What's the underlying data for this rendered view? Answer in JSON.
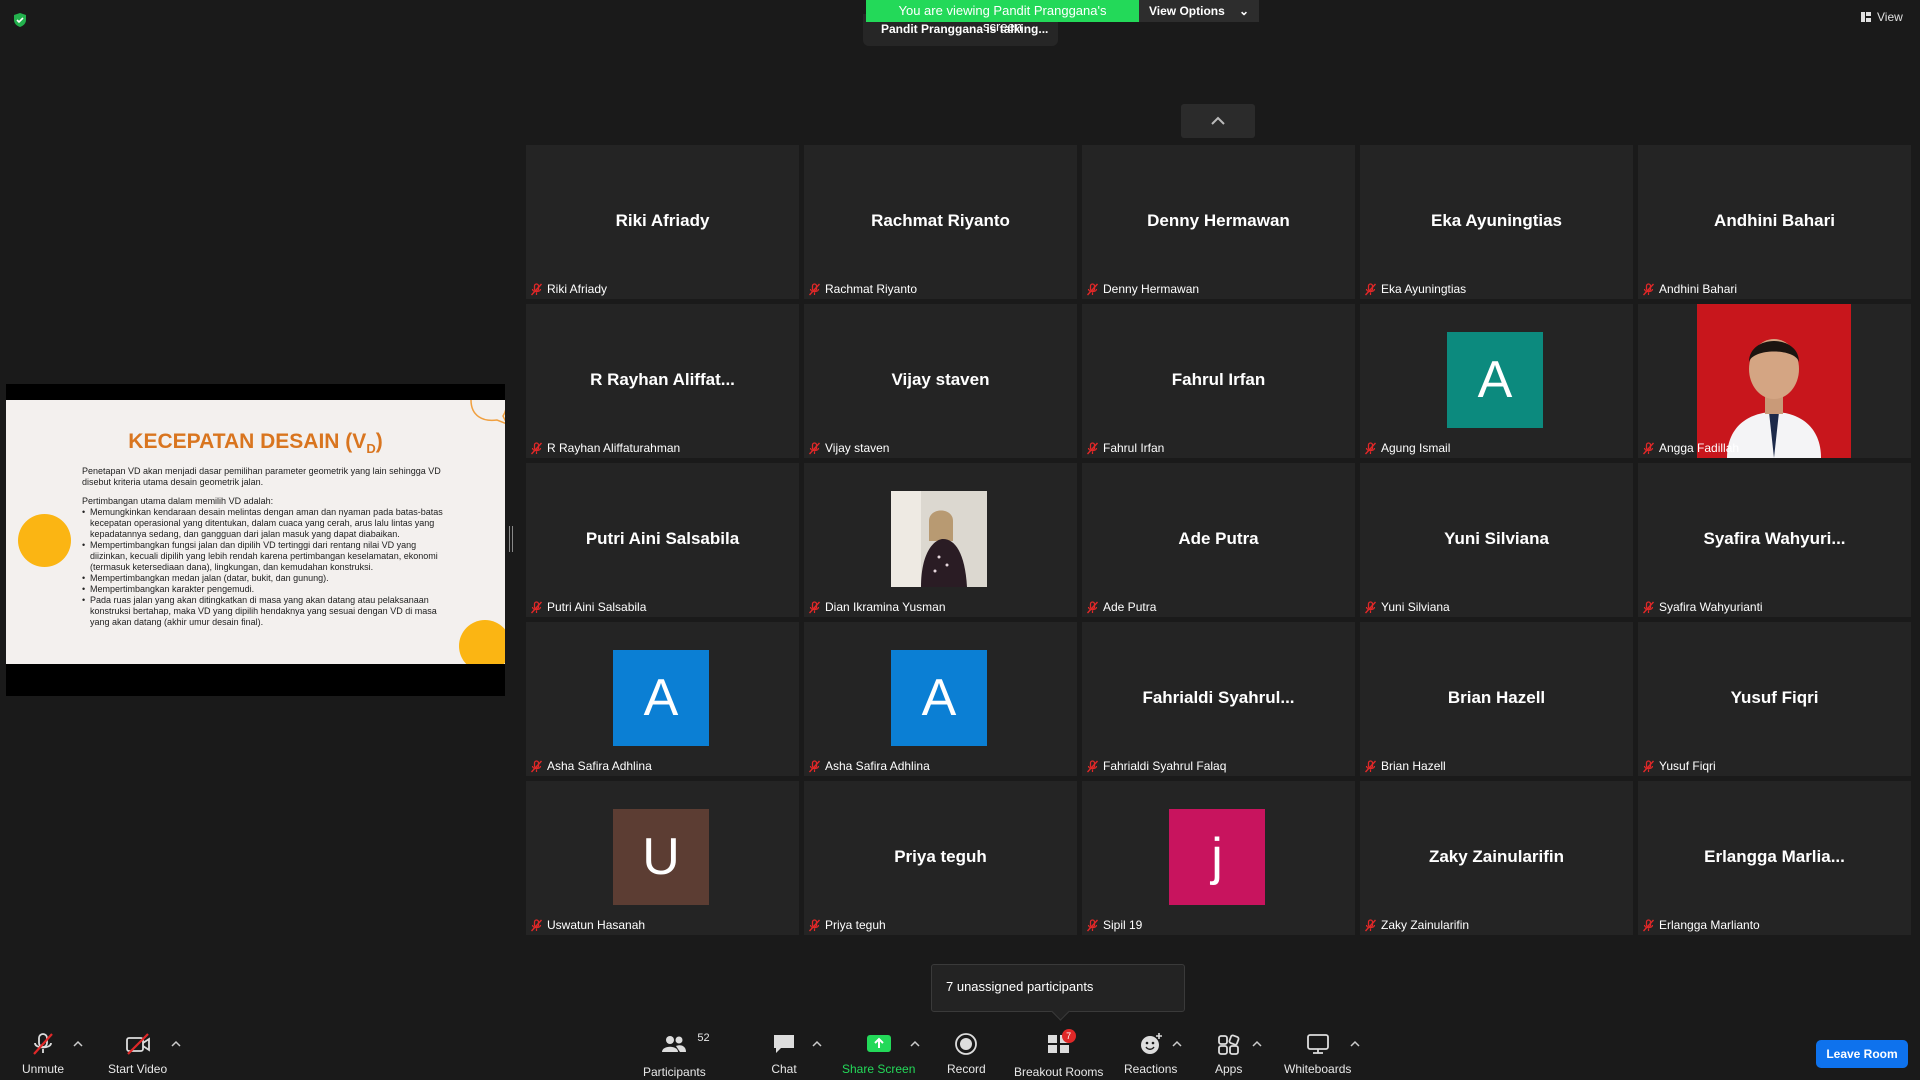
{
  "banner": {
    "viewing_text": "You are viewing Pandit Pranggana's screen",
    "view_options_label": "View Options",
    "talking_text": "Pandit Pranggana is talking..."
  },
  "top_right": {
    "view_label": "View"
  },
  "slide": {
    "title": "KECEPATAN DESAIN (V",
    "title_sub": "D",
    "title_end": ")",
    "intro": "Penetapan VD akan menjadi dasar pemilihan parameter geometrik yang lain sehingga VD disebut kriteria utama desain geometrik jalan.",
    "consider_heading": "Pertimbangan utama dalam memilih VD adalah:",
    "bullets": [
      "Memungkinkan kendaraan desain melintas dengan aman dan nyaman pada batas-batas kecepatan operasional yang ditentukan, dalam cuaca yang cerah, arus lalu lintas yang kepadatannya sedang, dan gangguan dari jalan masuk yang dapat diabaikan.",
      "Mempertimbangkan fungsi jalan dan dipilih VD tertinggi dari rentang nilai VD yang diizinkan, kecuali dipilih yang lebih rendah karena pertimbangan keselamatan, ekonomi (termasuk ketersediaan dana), lingkungan, dan kemudahan konstruksi.",
      "Mempertimbangkan medan jalan (datar, bukit, dan gunung).",
      "Mempertimbangkan karakter pengemudi.",
      "Pada ruas jalan yang akan ditingkatkan di masa yang akan datang atau pelaksanaan konstruksi bertahap, maka VD yang dipilih hendaknya yang sesuai dengan VD di masa yang akan datang (akhir umur desain final)."
    ]
  },
  "tiles": [
    {
      "center": "Riki Afriady",
      "label": "Riki Afriady",
      "type": "name"
    },
    {
      "center": "Rachmat Riyanto",
      "label": "Rachmat Riyanto",
      "type": "name"
    },
    {
      "center": "Denny Hermawan",
      "label": "Denny Hermawan",
      "type": "name"
    },
    {
      "center": "Eka Ayuningtias",
      "label": "Eka Ayuningtias",
      "type": "name"
    },
    {
      "center": "Andhini Bahari",
      "label": "Andhini Bahari",
      "type": "name"
    },
    {
      "center": "R Rayhan Aliffat...",
      "label": "R Rayhan Aliffaturahman",
      "type": "name"
    },
    {
      "center": "Vijay staven",
      "label": "Vijay staven",
      "type": "name"
    },
    {
      "center": "Fahrul Irfan",
      "label": "Fahrul Irfan",
      "type": "name"
    },
    {
      "center": "A",
      "label": "Agung Ismail",
      "type": "avatar",
      "color": "#0c8a7e"
    },
    {
      "center": "",
      "label": "Angga Fadillah",
      "type": "photo"
    },
    {
      "center": "Putri Aini Salsabila",
      "label": "Putri Aini Salsabila",
      "type": "name"
    },
    {
      "center": "",
      "label": "Dian Ikramina Yusman",
      "type": "photo-small"
    },
    {
      "center": "Ade Putra",
      "label": "Ade Putra",
      "type": "name"
    },
    {
      "center": "Yuni Silviana",
      "label": "Yuni Silviana",
      "type": "name"
    },
    {
      "center": "Syafira  Wahyuri...",
      "label": "Syafira Wahyurianti",
      "type": "name"
    },
    {
      "center": "A",
      "label": "Asha Safira Adhlina",
      "type": "avatar",
      "color": "#0b7fd4"
    },
    {
      "center": "A",
      "label": "Asha Safira Adhlina",
      "type": "avatar",
      "color": "#0b7fd4"
    },
    {
      "center": "Fahrialdi  Syahrul...",
      "label": "Fahrialdi Syahrul Falaq",
      "type": "name"
    },
    {
      "center": "Brian Hazell",
      "label": "Brian Hazell",
      "type": "name"
    },
    {
      "center": "Yusuf Fiqri",
      "label": "Yusuf Fiqri",
      "type": "name"
    },
    {
      "center": "U",
      "label": "Uswatun Hasanah",
      "type": "avatar",
      "color": "#5c3d33"
    },
    {
      "center": "Priya teguh",
      "label": "Priya teguh",
      "type": "name"
    },
    {
      "center": "j",
      "label": "Sipil 19",
      "type": "avatar",
      "color": "#c8145e"
    },
    {
      "center": "Zaky Zainularifin",
      "label": "Zaky Zainularifin",
      "type": "name"
    },
    {
      "center": "Erlangga  Marlia...",
      "label": "Erlangga Marlianto",
      "type": "name"
    }
  ],
  "popup": {
    "text": "7 unassigned participants"
  },
  "toolbar": {
    "unmute": "Unmute",
    "start_video": "Start Video",
    "participants": "Participants",
    "participants_count": "52",
    "chat": "Chat",
    "share_screen": "Share Screen",
    "record": "Record",
    "breakout_rooms": "Breakout Rooms",
    "breakout_badge": "7",
    "reactions": "Reactions",
    "apps": "Apps",
    "whiteboards": "Whiteboards",
    "leave_room": "Leave Room"
  },
  "colors": {
    "share_green": "#23d959",
    "leave_blue": "#0e72ed",
    "slide_title": "#d9751f",
    "slide_circle": "#fbb513",
    "mute_red": "#e02828"
  }
}
